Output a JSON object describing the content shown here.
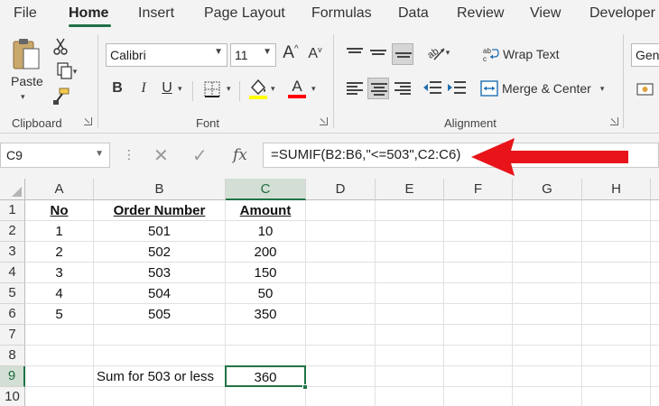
{
  "menu_tabs": [
    "File",
    "Home",
    "Insert",
    "Page Layout",
    "Formulas",
    "Data",
    "Review",
    "View",
    "Developer"
  ],
  "active_tab": "Home",
  "ribbon": {
    "clipboard": {
      "paste_label": "Paste",
      "group_label": "Clipboard"
    },
    "font": {
      "font_name": "Calibri",
      "font_size": "11",
      "bold": "B",
      "italic": "I",
      "underline": "U",
      "grow_label": "A",
      "shrink_label": "A",
      "font_color_label": "A",
      "group_label": "Font",
      "fill_color": "#ffff00",
      "font_color": "#ff0000"
    },
    "alignment": {
      "wrap_text": "Wrap Text",
      "merge_center": "Merge & Center",
      "group_label": "Alignment"
    },
    "number": {
      "format_value": "Gene"
    }
  },
  "formula_bar": {
    "name_box": "C9",
    "formula": "=SUMIF(B2:B6,\"<=503\",C2:C6)"
  },
  "grid": {
    "columns": [
      "A",
      "B",
      "C",
      "D",
      "E",
      "F",
      "G",
      "H"
    ],
    "rows": [
      "1",
      "2",
      "3",
      "4",
      "5",
      "6",
      "7",
      "8",
      "9",
      "10"
    ],
    "selected_column": "C",
    "selected_row": "9",
    "headers": {
      "a": "No",
      "b": "Order Number",
      "c": "Amount"
    },
    "data": [
      {
        "no": "1",
        "order": "501",
        "amount": "10"
      },
      {
        "no": "2",
        "order": "502",
        "amount": "200"
      },
      {
        "no": "3",
        "order": "503",
        "amount": "150"
      },
      {
        "no": "4",
        "order": "504",
        "amount": "50"
      },
      {
        "no": "5",
        "order": "505",
        "amount": "350"
      }
    ],
    "sum_label": "Sum for 503 or less",
    "sum_value": "360"
  },
  "colors": {
    "accent": "#217346",
    "annotation_arrow": "#e8141a"
  }
}
